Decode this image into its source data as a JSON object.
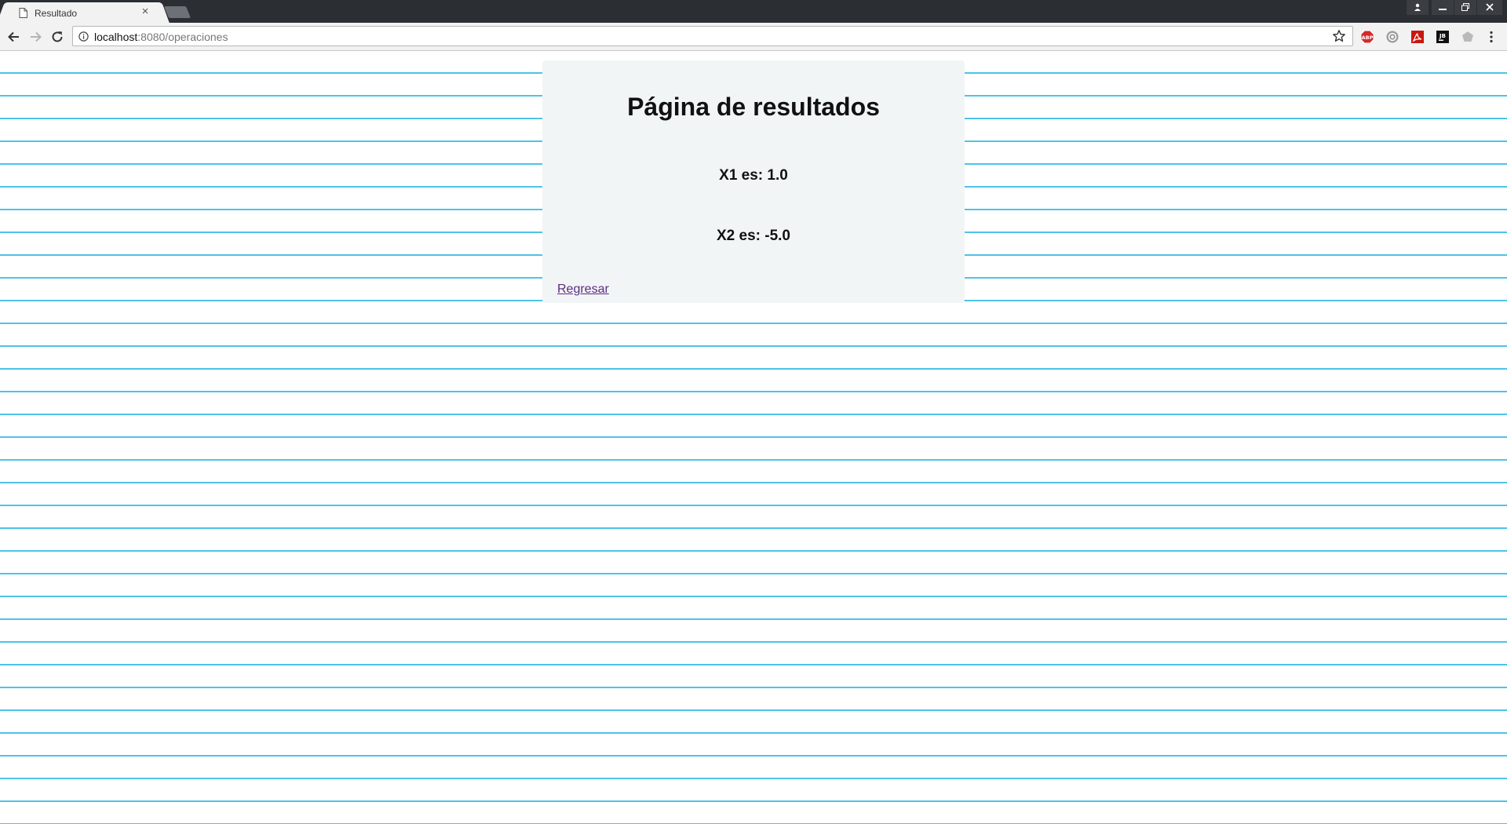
{
  "browser": {
    "tab": {
      "title": "Resultado",
      "close_glyph": "×",
      "favicon": "page-icon"
    },
    "window_controls": {
      "user_glyph": "👤",
      "minimize_glyph": "–",
      "restore_glyph": "❐",
      "close_glyph": "✕"
    },
    "address_bar": {
      "host": "localhost",
      "rest": ":8080/operaciones"
    },
    "extensions": [
      "adblock-plus-icon",
      "settings-extension-icon",
      "acrobat-icon",
      "jb-extension-icon",
      "shield-extension-icon"
    ],
    "colors": {
      "frame": "#2b2e33",
      "toolbar": "#f2f2f2"
    }
  },
  "page": {
    "title": "Página de resultados",
    "x1": "X1 es: 1.0",
    "x2": "X2 es: -5.0",
    "back_link": "Regresar",
    "colors": {
      "ruled_lines": "#4ec3e8",
      "card_bg": "#f2f5f6",
      "visited_link": "#5b2c83"
    }
  }
}
